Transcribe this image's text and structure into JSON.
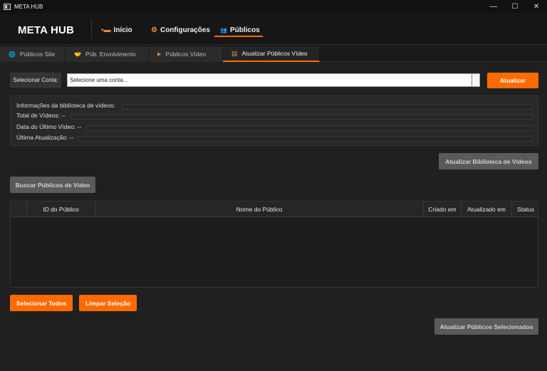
{
  "window": {
    "title": "META HUB",
    "controls": [
      "—",
      "☐",
      "✕"
    ]
  },
  "header": {
    "logo": "META HUB",
    "nav": [
      {
        "label": "Início",
        "icon": "chart-icon",
        "glyph": "▪▬"
      },
      {
        "label": "Configurações",
        "icon": "gear-icon",
        "glyph": "⚙"
      },
      {
        "label": "Públicos",
        "icon": "users-icon",
        "glyph": "👥"
      }
    ],
    "active_nav": "Públicos",
    "accent": "#ff6b00"
  },
  "tabs": [
    {
      "label": "Públicos Site",
      "icon": "globe-icon",
      "glyph": "🌐"
    },
    {
      "label": "Púb. Envolvimento",
      "icon": "handshake-icon",
      "glyph": "🤝"
    },
    {
      "label": "Públicos Vídeo",
      "icon": "play-icon",
      "glyph": "▶"
    },
    {
      "label": "Atualizar Públicos Vídeo",
      "icon": "video-list-icon",
      "glyph": "▤"
    }
  ],
  "active_tab": "Atualizar Públicos Vídeo",
  "account": {
    "label": "Selecionar Conta:",
    "placeholder": "Selecione uma conta...",
    "update_button": "Atualizar"
  },
  "library_info": {
    "heading": "Informações da biblioteca de vídeos:",
    "total_videos": "Total de Vídeos: --",
    "last_video_date": "Data do Último Vídeo: --",
    "last_update": "Última Atualização: --"
  },
  "buttons": {
    "update_library": "Atualizar Biblioteca de Vídeos",
    "search_audiences": "Buscar Públicos de Vídeo",
    "select_all": "Selecionar Todos",
    "clear_selection": "Limpar Seleção",
    "update_selected": "Atualizar Públicos Selecionados"
  },
  "table": {
    "columns": [
      "",
      "ID do Público",
      "Nome do Público",
      "Criado em",
      "Atualizado em",
      "Status"
    ],
    "rows": []
  }
}
